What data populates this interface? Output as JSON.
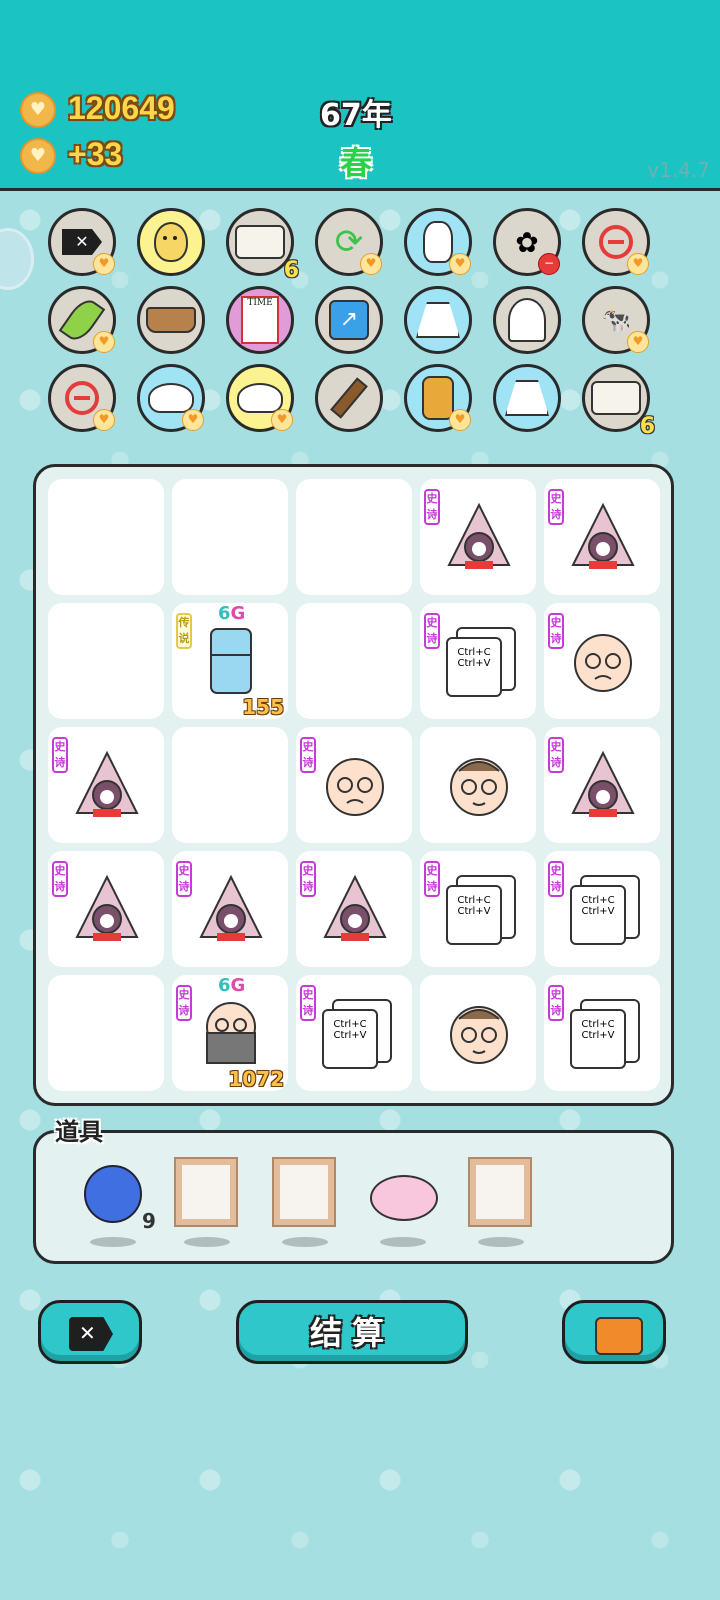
{
  "header": {
    "coins": "120649",
    "income": "+33",
    "year": "67年",
    "season": "春",
    "version": "v1.4.7"
  },
  "icon_grid": {
    "row1": [
      {
        "name": "delete-tag",
        "badge": "heart"
      },
      {
        "name": "chick-egg"
      },
      {
        "name": "egg-tray",
        "count": "6"
      },
      {
        "name": "recycle",
        "badge": "heart"
      },
      {
        "name": "rabbit",
        "badge": "heart"
      },
      {
        "name": "flower-pot",
        "badge": "minus"
      },
      {
        "name": "minus",
        "badge": "heart"
      }
    ],
    "row2": [
      {
        "name": "leaf",
        "badge": "heart"
      },
      {
        "name": "dog-food-bowl"
      },
      {
        "name": "time-magazine",
        "label": "TIME"
      },
      {
        "name": "arrow-card"
      },
      {
        "name": "skirt"
      },
      {
        "name": "ghost"
      },
      {
        "name": "cows",
        "badge": "heart"
      }
    ],
    "row3": [
      {
        "name": "minus",
        "badge": "heart"
      },
      {
        "name": "rice-bowl",
        "badge": "heart"
      },
      {
        "name": "rice-bowl",
        "badge": "heart"
      },
      {
        "name": "hammer"
      },
      {
        "name": "cat",
        "badge": "heart"
      },
      {
        "name": "skirt"
      },
      {
        "name": "egg-tray",
        "count": "6"
      }
    ]
  },
  "board": {
    "rarity_epic": "史诗",
    "rarity_legend": "传说",
    "copy_card": {
      "line1": "Ctrl+C",
      "line2": "Ctrl+V"
    },
    "fridge": {
      "level_num": "6",
      "level_g": "G",
      "count": "155"
    },
    "old_man": {
      "level_num": "6",
      "level_g": "G",
      "count": "1072"
    }
  },
  "tools": {
    "label": "道具",
    "blueberry_count": "9"
  },
  "buttons": {
    "settle": "结算"
  }
}
